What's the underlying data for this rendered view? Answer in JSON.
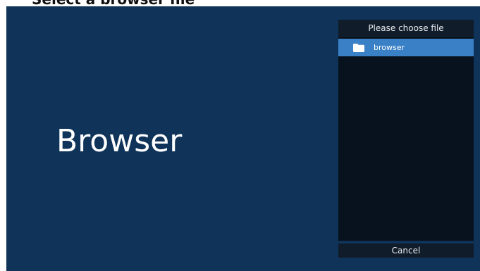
{
  "caption": "Select a browser file",
  "main": {
    "title": "Browser"
  },
  "dialog": {
    "title": "Please choose file",
    "items": [
      {
        "label": "browser",
        "icon": "folder-icon",
        "selected": true
      }
    ],
    "cancel_label": "Cancel"
  },
  "colors": {
    "background": "#0f3359",
    "dialog_header": "#101c2a",
    "list_background": "#08121e",
    "selection": "#3a80c7"
  }
}
